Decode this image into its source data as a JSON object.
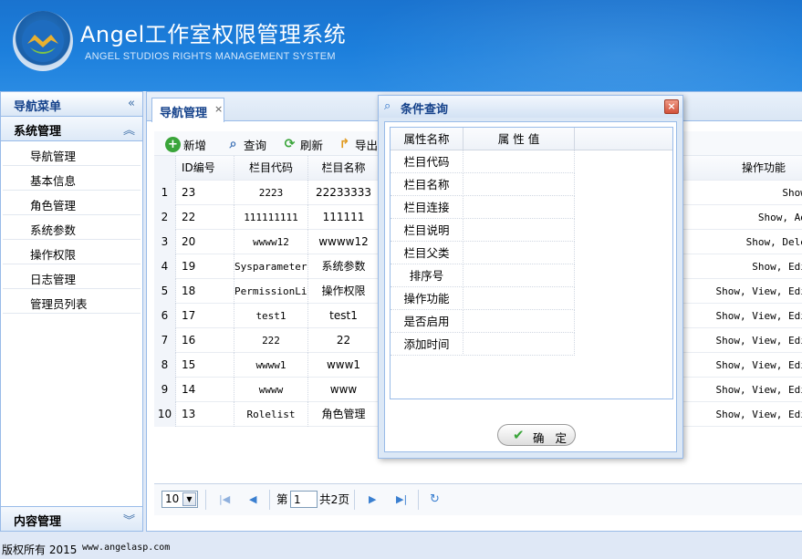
{
  "header": {
    "title": "Angel工作室权限管理系统",
    "subtitle": "ANGEL STUDIOS RIGHTS MANAGEMENT SYSTEM"
  },
  "sidebar": {
    "title": "导航菜单",
    "section": "系统管理",
    "items": [
      "导航管理",
      "基本信息",
      "角色管理",
      "系统参数",
      "操作权限",
      "日志管理",
      "管理员列表"
    ],
    "bottom_section": "内容管理"
  },
  "tab": {
    "label": "导航管理",
    "close": "×"
  },
  "toolbar": {
    "add": "新增",
    "search": "查询",
    "refresh": "刷新",
    "export": "导出"
  },
  "grid": {
    "columns": [
      "ID编号",
      "栏目代码",
      "栏目名称",
      "操作功能"
    ],
    "rows": [
      {
        "n": "1",
        "id": "23",
        "code": "2223",
        "name": "22233333",
        "ops": "Show, Add"
      },
      {
        "n": "2",
        "id": "22",
        "code": "111111111",
        "name": "111111",
        "ops": "Show, Add, Ed"
      },
      {
        "n": "3",
        "id": "20",
        "code": "wwww12",
        "name": "wwww12",
        "ops": "Show, Delete, V"
      },
      {
        "n": "4",
        "id": "19",
        "code": "SysparameterL",
        "name": "系统参数",
        "ops": "Show, Edit, Vi"
      },
      {
        "n": "5",
        "id": "18",
        "code": "PermissionLis",
        "name": "操作权限",
        "ops": "Show, View, Edit, Ad"
      },
      {
        "n": "6",
        "id": "17",
        "code": "test1",
        "name": "test1",
        "ops": "Show, View, Edit, Ad"
      },
      {
        "n": "7",
        "id": "16",
        "code": "222",
        "name": "22",
        "ops": "Show, View, Edit, Ad"
      },
      {
        "n": "8",
        "id": "15",
        "code": "wwww1",
        "name": "www1",
        "ops": "Show, View, Edit, Ad"
      },
      {
        "n": "9",
        "id": "14",
        "code": "wwww",
        "name": "www",
        "ops": "Show, View, Edit, Ad"
      },
      {
        "n": "10",
        "id": "13",
        "code": "Rolelist",
        "name": "角色管理",
        "ops": "Show, View, Edit, Ad"
      }
    ]
  },
  "pager": {
    "page_size": "10",
    "page_prefix": "第",
    "page_value": "1",
    "total": "共2页"
  },
  "dialog": {
    "title": "条件查询",
    "close": "×",
    "head_key": "属性名称",
    "head_value": "属 性 值",
    "fields": [
      "栏目代码",
      "栏目名称",
      "栏目连接",
      "栏目说明",
      "栏目父类",
      "排序号",
      "操作功能",
      "是否启用",
      "添加时间"
    ],
    "ok": "确 定"
  },
  "footer": {
    "copyright": "版权所有 2015",
    "url": "www.angelasp.com"
  }
}
